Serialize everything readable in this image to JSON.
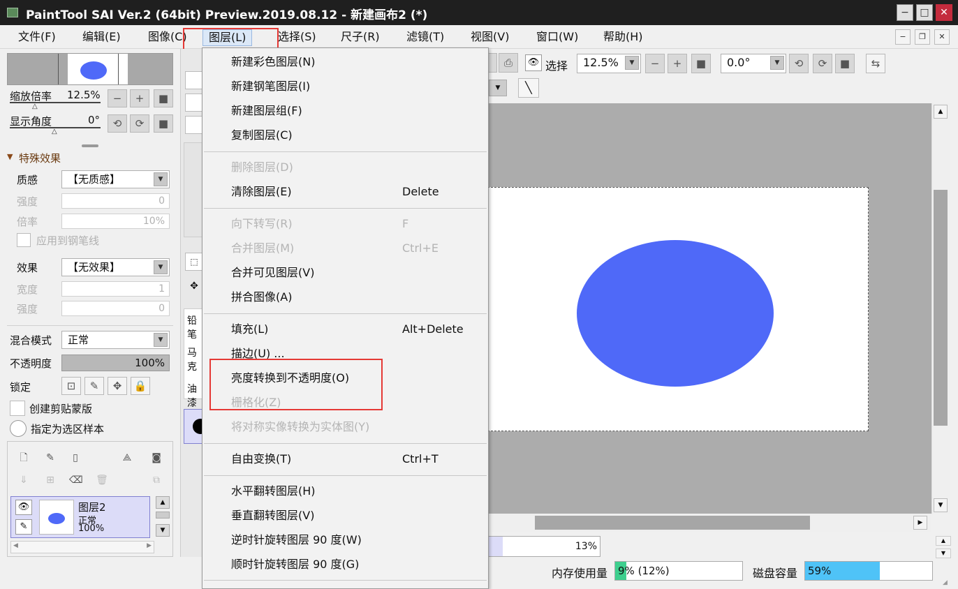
{
  "window": {
    "title": "PaintTool SAI Ver.2 (64bit) Preview.2019.08.12 - 新建画布2 (*)",
    "min": "−",
    "max": "□",
    "close": "✕"
  },
  "menubar": {
    "items": [
      "文件(F)",
      "编辑(E)",
      "图像(C)",
      "图层(L)",
      "选择(S)",
      "尺子(R)",
      "滤镜(T)",
      "视图(V)",
      "窗口(W)",
      "帮助(H)"
    ],
    "active": "图层(L)"
  },
  "navigator": {
    "zoom_label": "缩放倍率",
    "zoom_value": "12.5%",
    "angle_label": "显示角度",
    "angle_value": "0°"
  },
  "effects": {
    "section_title": "特殊效果",
    "texture_label": "质感",
    "texture_value": "【无质感】",
    "strength_label": "强度",
    "strength_value": "0",
    "scale_label": "倍率",
    "scale_value": "10%",
    "apply_pen_label": "应用到钢笔线",
    "effect_label": "效果",
    "effect_value": "【无效果】",
    "width_label": "宽度",
    "width_value": "1",
    "strength2_label": "强度",
    "strength2_value": "0"
  },
  "layer_props": {
    "blend_label": "混合模式",
    "blend_value": "正常",
    "opacity_label": "不透明度",
    "opacity_value": "100%",
    "lock_label": "锁定",
    "clip_label": "创建剪贴蒙版",
    "sample_label": "指定为选区样本"
  },
  "layers": [
    {
      "name": "图层2",
      "mode": "正常",
      "opacity": "100%"
    }
  ],
  "brush_strip": [
    "铅笔",
    "马克",
    "油漆"
  ],
  "toolbar": {
    "select_label": "选择",
    "zoom_value": "12.5%",
    "angle_value": "0.0°"
  },
  "dropdown": {
    "items": [
      {
        "label": "新建彩色图层(N)",
        "shortcut": "",
        "disabled": false
      },
      {
        "label": "新建钢笔图层(I)",
        "shortcut": "",
        "disabled": false
      },
      {
        "label": "新建图层组(F)",
        "shortcut": "",
        "disabled": false
      },
      {
        "label": "复制图层(C)",
        "shortcut": "",
        "disabled": false
      },
      {
        "label": "删除图层(D)",
        "shortcut": "",
        "disabled": true
      },
      {
        "label": "清除图层(E)",
        "shortcut": "Delete",
        "disabled": false
      },
      {
        "label": "向下转写(R)",
        "shortcut": "F",
        "disabled": true
      },
      {
        "label": "合并图层(M)",
        "shortcut": "Ctrl+E",
        "disabled": true
      },
      {
        "label": "合并可见图层(V)",
        "shortcut": "",
        "disabled": false
      },
      {
        "label": "拼合图像(A)",
        "shortcut": "",
        "disabled": false
      },
      {
        "label": "填充(L)",
        "shortcut": "Alt+Delete",
        "disabled": false
      },
      {
        "label": "描边(U) ...",
        "shortcut": "",
        "disabled": false
      },
      {
        "label": "亮度转换到不透明度(O)",
        "shortcut": "",
        "disabled": false
      },
      {
        "label": "栅格化(Z)",
        "shortcut": "",
        "disabled": true
      },
      {
        "label": "将对称实像转换为实体图(Y)",
        "shortcut": "",
        "disabled": true
      },
      {
        "label": "自由变换(T)",
        "shortcut": "Ctrl+T",
        "disabled": false
      },
      {
        "label": "水平翻转图层(H)",
        "shortcut": "",
        "disabled": false
      },
      {
        "label": "垂直翻转图层(V)",
        "shortcut": "",
        "disabled": false
      },
      {
        "label": "逆时针旋转图层 90 度(W)",
        "shortcut": "",
        "disabled": false
      },
      {
        "label": "顺时针旋转图层 90 度(G)",
        "shortcut": "",
        "disabled": false
      }
    ]
  },
  "status": {
    "progress_value": "13%",
    "progress_fraction": 0.13,
    "memory_label": "内存使用量",
    "memory_value": "9% (12%)",
    "memory_fraction": 0.09,
    "disk_label": "磁盘容量",
    "disk_value": "59%",
    "disk_fraction": 0.59
  },
  "colors": {
    "ellipse": "#4f69f8",
    "highlight": "#e53935",
    "disk_bar": "#4fc3f7",
    "memory_bar": "#3ecf8e"
  }
}
